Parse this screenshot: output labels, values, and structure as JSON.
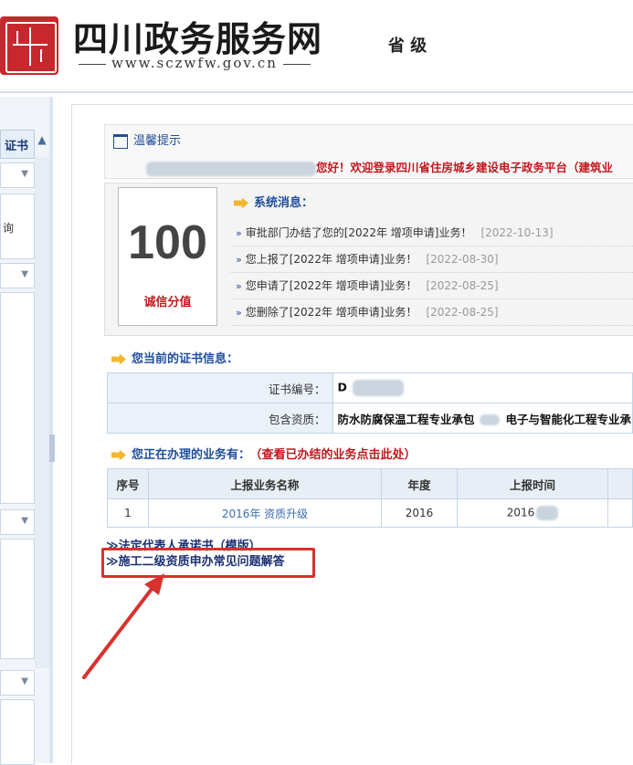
{
  "header": {
    "site_title": "四川政务服务网",
    "site_url": "www.sczwfw.gov.cn",
    "province": "省 级",
    "brand_color": "#c8272d"
  },
  "sidebar": {
    "tab_label": "证书",
    "items": [
      "询"
    ]
  },
  "tip": {
    "title": "温馨提示",
    "message": "您好！欢迎登录四川省住房城乡建设电子政务平台（建筑业"
  },
  "score": {
    "value": "100",
    "label": "诚信分值"
  },
  "system_messages": {
    "title": "系统消息：",
    "items": [
      {
        "text": "审批部门办结了您的[2022年 增项申请]业务！",
        "date": "[2022-10-13]"
      },
      {
        "text": "您上报了[2022年 增项申请]业务！",
        "date": "[2022-08-30]"
      },
      {
        "text": "您申请了[2022年 增项申请]业务！",
        "date": "[2022-08-25]"
      },
      {
        "text": "您删除了[2022年 增项申请]业务！",
        "date": "[2022-08-25]"
      }
    ]
  },
  "certificate": {
    "title": "您当前的证书信息：",
    "rows": [
      {
        "label": "证书编号：",
        "value": "D"
      },
      {
        "label": "包含资质：",
        "value": "防水防腐保温工程专业承包",
        "value2": "电子与智能化工程专业承"
      }
    ]
  },
  "business": {
    "title": "您正在办理的业务有：",
    "link": "（查看已办结的业务点击此处）",
    "columns": [
      "序号",
      "上报业务名称",
      "年度",
      "上报时间"
    ],
    "rows": [
      {
        "no": "1",
        "name": "2016年 资质升级",
        "year": "2016",
        "time": "2016"
      }
    ]
  },
  "links": [
    "法定代表人承诺书（模版）",
    "施工二级资质申办常见问题解答"
  ],
  "colors": {
    "accent_blue": "#1f4e9a",
    "alert_red": "#c0181e",
    "highlight_red": "#d8322d"
  }
}
